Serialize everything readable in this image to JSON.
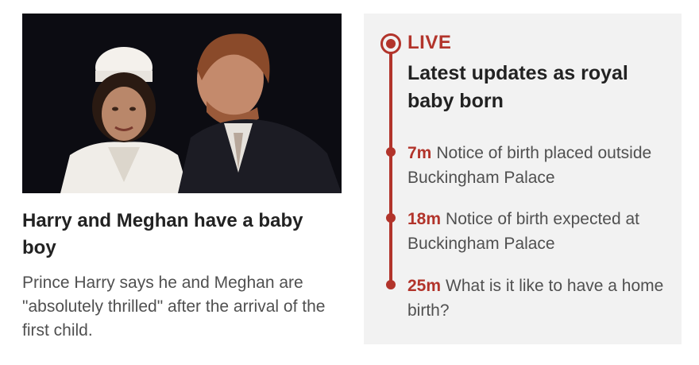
{
  "story": {
    "title": "Harry and Meghan have a baby boy",
    "summary": "Prince Harry says he and Meghan are \"absolutely thrilled\" after the arrival of the first child."
  },
  "live": {
    "label": "LIVE",
    "headline": "Latest updates as royal baby born",
    "updates": [
      {
        "time": "7m",
        "text": "Notice of birth placed outside Buckingham Palace"
      },
      {
        "time": "18m",
        "text": "Notice of birth expected at Buckingham Palace"
      },
      {
        "time": "25m",
        "text": "What is it like to have a home birth?"
      }
    ]
  },
  "colors": {
    "accent": "#b2342b",
    "panel_bg": "#f2f2f2",
    "text_dark": "#222222",
    "text_muted": "#505050"
  },
  "icons": {
    "live_indicator": "live-indicator-icon",
    "timeline_marker": "timeline-dot-icon"
  }
}
